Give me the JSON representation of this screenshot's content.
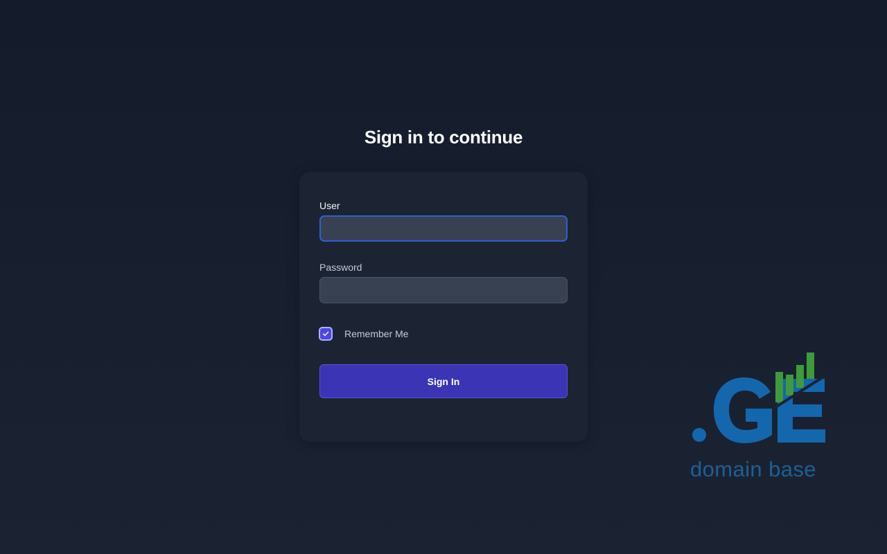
{
  "page": {
    "heading": "Sign in to continue"
  },
  "form": {
    "user_label": "User",
    "user_value": "",
    "password_label": "Password",
    "password_value": "",
    "remember_label": "Remember Me",
    "remember_checked": true,
    "submit_label": "Sign In"
  },
  "brand": {
    "logo_mark": ".GE",
    "logo_text": "domain base",
    "colors": {
      "logo_blue": "#1467ad",
      "logo_green": "#3f9a3a",
      "accent": "#3b34b5"
    }
  }
}
